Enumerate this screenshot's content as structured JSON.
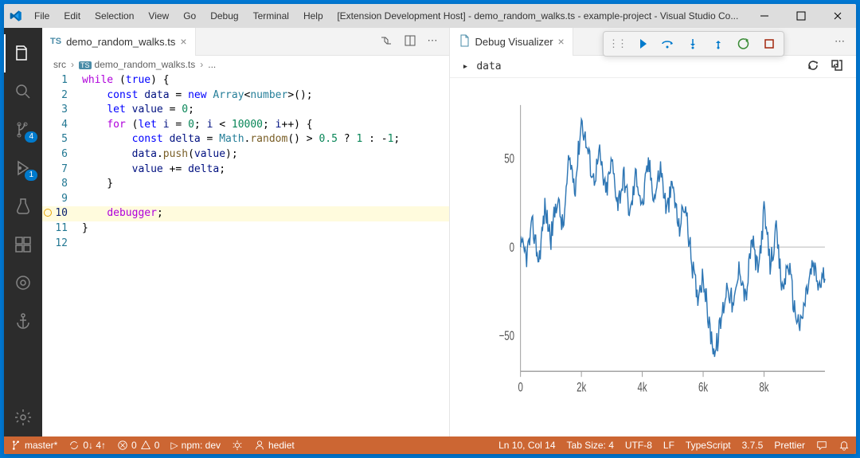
{
  "titlebar": {
    "menus": [
      "File",
      "Edit",
      "Selection",
      "View",
      "Go",
      "Debug",
      "Terminal",
      "Help"
    ],
    "title": "[Extension Development Host] - demo_random_walks.ts - example-project - Visual Studio Co..."
  },
  "activity": {
    "items": [
      {
        "name": "explorer",
        "badge": null,
        "active": true
      },
      {
        "name": "search",
        "badge": null
      },
      {
        "name": "scm",
        "badge": "4"
      },
      {
        "name": "debug",
        "badge": "1"
      },
      {
        "name": "testing",
        "badge": null
      },
      {
        "name": "extensions",
        "badge": null
      },
      {
        "name": "target",
        "badge": null
      },
      {
        "name": "anchor",
        "badge": null
      }
    ]
  },
  "editor": {
    "tab": {
      "icon": "TS",
      "label": "demo_random_walks.ts"
    },
    "breadcrumb": [
      "src",
      "demo_random_walks.ts",
      "..."
    ],
    "lines": [
      {
        "n": 1,
        "html": "<span class='tok-ctrl'>while</span> (<span class='tok-const'>true</span>) {"
      },
      {
        "n": 2,
        "html": "    <span class='tok-kw'>const</span> <span class='tok-var'>data</span> = <span class='tok-kw'>new</span> <span class='tok-cls'>Array</span>&lt;<span class='tok-type'>number</span>&gt;();"
      },
      {
        "n": 3,
        "html": "    <span class='tok-kw'>let</span> <span class='tok-var'>value</span> = <span class='tok-num'>0</span>;"
      },
      {
        "n": 4,
        "html": "    <span class='tok-ctrl'>for</span> (<span class='tok-kw'>let</span> <span class='tok-var'>i</span> = <span class='tok-num'>0</span>; <span class='tok-var'>i</span> &lt; <span class='tok-num'>10000</span>; <span class='tok-var'>i</span>++) {"
      },
      {
        "n": 5,
        "html": "        <span class='tok-kw'>const</span> <span class='tok-var'>delta</span> = <span class='tok-cls'>Math</span>.<span class='tok-fn'>random</span>() &gt; <span class='tok-num'>0.5</span> ? <span class='tok-num'>1</span> : -<span class='tok-num'>1</span>;"
      },
      {
        "n": 6,
        "html": "        <span class='tok-var'>data</span>.<span class='tok-fn'>push</span>(<span class='tok-var'>value</span>);"
      },
      {
        "n": 7,
        "html": "        <span class='tok-var'>value</span> += <span class='tok-var'>delta</span>;"
      },
      {
        "n": 8,
        "html": "    }"
      },
      {
        "n": 9,
        "html": ""
      },
      {
        "n": 10,
        "html": "    <span class='tok-ctrl'>debugger</span>;",
        "current": true,
        "bp": true
      },
      {
        "n": 11,
        "html": "}"
      },
      {
        "n": 12,
        "html": ""
      }
    ]
  },
  "visualizer": {
    "tab": "Debug Visualizer",
    "expr": "data"
  },
  "debugToolbar": [
    "continue",
    "step-over",
    "step-into",
    "step-out",
    "restart",
    "stop"
  ],
  "status": {
    "branch": "master*",
    "sync": "0↓ 4↑",
    "problems": "0  0",
    "task": "npm: dev",
    "live": "hediet",
    "cursor": "Ln 10, Col 14",
    "tab": "Tab Size: 4",
    "enc": "UTF-8",
    "eol": "LF",
    "lang": "TypeScript",
    "ver": "3.7.5",
    "prettier": "Prettier"
  },
  "chart_data": {
    "type": "line",
    "title": "",
    "xlabel": "",
    "ylabel": "",
    "xlim": [
      0,
      10000
    ],
    "ylim": [
      -70,
      80
    ],
    "xticks": [
      0,
      2000,
      4000,
      6000,
      8000
    ],
    "xtick_labels": [
      "0",
      "2k",
      "4k",
      "6k",
      "8k"
    ],
    "yticks": [
      -50,
      0,
      50
    ],
    "ytick_labels": [
      "−50",
      "0",
      "50"
    ],
    "series": [
      {
        "name": "data",
        "color": "#2e76b4",
        "approx_points": [
          [
            0,
            0
          ],
          [
            200,
            -5
          ],
          [
            400,
            12
          ],
          [
            600,
            -8
          ],
          [
            800,
            22
          ],
          [
            1000,
            5
          ],
          [
            1200,
            28
          ],
          [
            1400,
            10
          ],
          [
            1600,
            50
          ],
          [
            1800,
            35
          ],
          [
            2000,
            72
          ],
          [
            2200,
            55
          ],
          [
            2400,
            38
          ],
          [
            2600,
            52
          ],
          [
            2800,
            30
          ],
          [
            3000,
            48
          ],
          [
            3200,
            25
          ],
          [
            3400,
            40
          ],
          [
            3600,
            18
          ],
          [
            3800,
            42
          ],
          [
            4000,
            22
          ],
          [
            4200,
            48
          ],
          [
            4400,
            28
          ],
          [
            4600,
            45
          ],
          [
            4800,
            20
          ],
          [
            5000,
            35
          ],
          [
            5200,
            10
          ],
          [
            5400,
            25
          ],
          [
            5600,
            -5
          ],
          [
            5800,
            -28
          ],
          [
            6000,
            -15
          ],
          [
            6200,
            -45
          ],
          [
            6400,
            -60
          ],
          [
            6600,
            -40
          ],
          [
            6800,
            -20
          ],
          [
            7000,
            -35
          ],
          [
            7200,
            -10
          ],
          [
            7400,
            -30
          ],
          [
            7600,
            5
          ],
          [
            7800,
            -15
          ],
          [
            8000,
            20
          ],
          [
            8200,
            -10
          ],
          [
            8400,
            8
          ],
          [
            8600,
            -25
          ],
          [
            8800,
            -8
          ],
          [
            9000,
            -35
          ],
          [
            9200,
            -45
          ],
          [
            9400,
            -25
          ],
          [
            9600,
            -10
          ],
          [
            9800,
            -22
          ],
          [
            9999,
            -15
          ]
        ]
      }
    ]
  }
}
